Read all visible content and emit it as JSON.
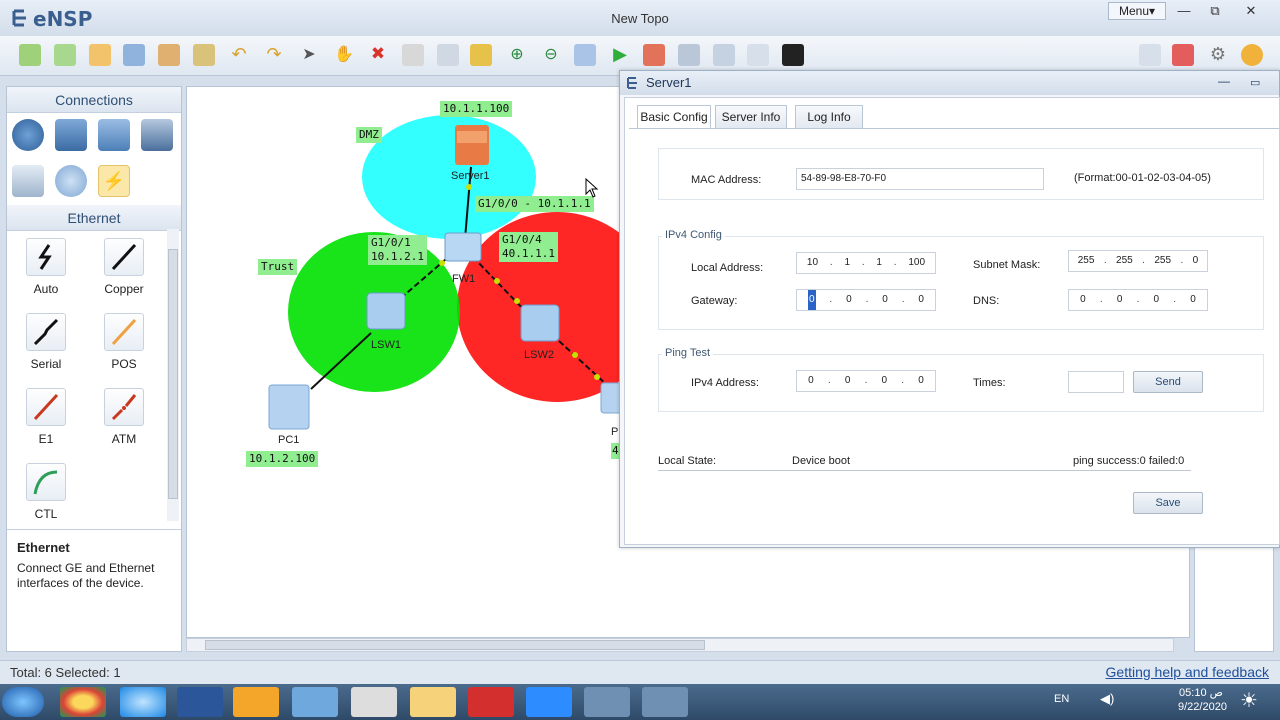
{
  "app": {
    "name": "eNSP",
    "window_title": "New Topo",
    "menu_label": "Menu▾",
    "minimize": "—",
    "restore": "⧉",
    "close": "✕"
  },
  "toolbar": {
    "icons": [
      "new-topo-icon",
      "new-example-icon",
      "open-icon",
      "save-icon",
      "save-as-icon",
      "print-icon",
      "undo-icon",
      "redo-icon",
      "select-icon",
      "pan-icon",
      "delete-icon",
      "delete-link-icon",
      "text-icon",
      "palette-icon",
      "zoom-in-icon",
      "zoom-out-icon",
      "fit-icon",
      "start-icon",
      "stop-icon",
      "capture-icon",
      "topology-icon",
      "grid-icon",
      "terminal-icon"
    ],
    "right_icons": [
      "chat-icon",
      "huawei-icon",
      "settings-icon",
      "help-icon"
    ]
  },
  "left_panel": {
    "connections_title": "Connections",
    "ethernet_title": "Ethernet",
    "cables": [
      {
        "label": "Auto"
      },
      {
        "label": "Copper"
      },
      {
        "label": "Serial"
      },
      {
        "label": "POS"
      },
      {
        "label": "E1"
      },
      {
        "label": "ATM"
      },
      {
        "label": "CTL"
      }
    ],
    "desc_title": "Ethernet",
    "desc_text": "Connect GE and Ethernet interfaces of the device."
  },
  "topology": {
    "zones": {
      "dmz": "DMZ",
      "trust": "Trust"
    },
    "server_ip": "10.1.1.100",
    "server_name": "Server1",
    "fw_name": "FW1",
    "lsw1": "LSW1",
    "lsw2": "LSW2",
    "pc1": "PC1",
    "pc1_ip": "10.1.2.100",
    "if_g100": "G1/0/0 - 10.1.1.1",
    "if_g101_a": "G1/0/1",
    "if_g101_b": "10.1.2.1",
    "if_g104_a": "G1/0/4",
    "if_g104_b": "40.1.1.1",
    "pc2_partial": "P",
    "pc2_ip_partial": "4"
  },
  "server_window": {
    "title": "Server1",
    "tabs": [
      "Basic Config",
      "Server Info",
      "Log Info"
    ],
    "mac_label": "MAC Address:",
    "mac_value": "54-89-98-E8-70-F0",
    "mac_format": "(Format:00-01-02-03-04-05)",
    "ipv4_group": "IPv4 Config",
    "local_addr_label": "Local Address:",
    "local_addr": [
      "10",
      "1",
      "1",
      "100"
    ],
    "subnet_label": "Subnet Mask:",
    "subnet": [
      "255",
      "255",
      "255",
      "0"
    ],
    "gateway_label": "Gateway:",
    "gateway": [
      "0",
      "0",
      "0",
      "0"
    ],
    "dns_label": "DNS:",
    "dns": [
      "0",
      "0",
      "0",
      "0"
    ],
    "ping_group": "Ping Test",
    "ping_ip_label": "IPv4 Address:",
    "ping_ip": [
      "0",
      "0",
      "0",
      "0"
    ],
    "times_label": "Times:",
    "times_value": "",
    "send_label": "Send",
    "local_state_label": "Local State:",
    "local_state_value": "Device boot",
    "ping_result": "ping success:0 failed:0",
    "save_label": "Save"
  },
  "status": {
    "left": "Total: 6  Selected: 1",
    "right": "Getting help and feedback"
  },
  "taskbar": {
    "lang": "EN",
    "time": "05:10 ص",
    "date": "9/22/2020"
  }
}
